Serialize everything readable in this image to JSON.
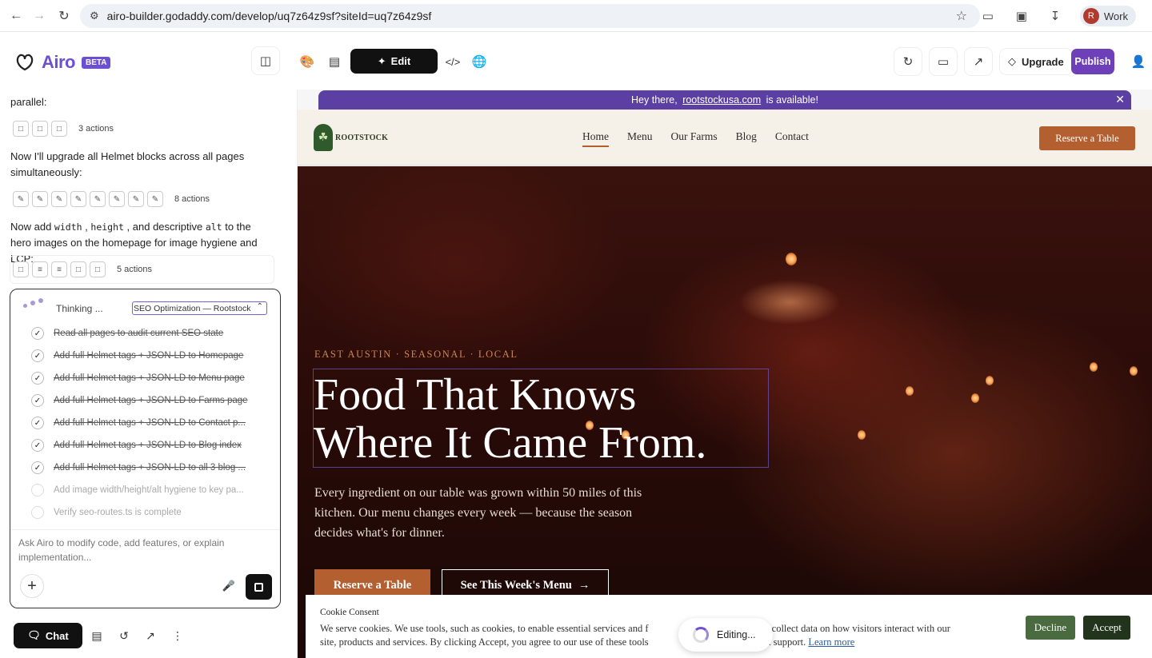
{
  "browser": {
    "url": "airo-builder.godaddy.com/develop/uq7z64z9sf?siteId=uq7z64z9sf",
    "profile_initial": "R",
    "profile_label": "Work"
  },
  "app": {
    "brand": "Airo",
    "badge": "BETA",
    "edit_label": "Edit",
    "upgrade_label": "Upgrade",
    "publish_label": "Publish"
  },
  "chat": {
    "messages": [
      {
        "text": "parallel:"
      },
      {
        "text": "Now I'll upgrade all Helmet blocks across all pages simultaneously:"
      }
    ],
    "msg3": {
      "part1": "Now add ",
      "code1": "width",
      "part2": " , ",
      "code2": "height",
      "part3": " , and descriptive ",
      "code3": "alt",
      "part4": " to the hero images on the homepage for image hygiene and LCP:"
    },
    "action_counts": [
      "3 actions",
      "8 actions",
      "5 actions"
    ],
    "thinking_label": "Thinking ...",
    "task_select_value": "SEO Optimization — Rootstock",
    "tasks": [
      {
        "label": "Read all pages to audit current SEO state",
        "done": true
      },
      {
        "label": "Add full Helmet tags + JSON-LD to Homepage",
        "done": true
      },
      {
        "label": "Add full Helmet tags + JSON-LD to Menu page",
        "done": true
      },
      {
        "label": "Add full Helmet tags + JSON-LD to Farms page",
        "done": true
      },
      {
        "label": "Add full Helmet tags + JSON-LD to Contact p...",
        "done": true
      },
      {
        "label": "Add full Helmet tags + JSON-LD to Blog index",
        "done": true
      },
      {
        "label": "Add full Helmet tags + JSON-LD to all 3 blog ...",
        "done": true
      },
      {
        "label": "Add image width/height/alt hygiene to key pa...",
        "done": false
      },
      {
        "label": "Verify seo-routes.ts is complete",
        "done": false
      }
    ],
    "input_placeholder": "Ask Airo to modify code, add features, or explain implementation...",
    "chat_tab_label": "Chat"
  },
  "site": {
    "promo": {
      "prefix": "Hey there,",
      "domain": "rootstockusa.com",
      "suffix": "is available!"
    },
    "logo_text": "ROOTSTOCK",
    "nav": [
      "Home",
      "Menu",
      "Our Farms",
      "Blog",
      "Contact"
    ],
    "reserve_label": "Reserve a Table",
    "hero": {
      "eyebrow": "EAST AUSTIN · SEASONAL · LOCAL",
      "title_line1": "Food That Knows",
      "title_line2": "Where It Came From.",
      "subtitle": "Every ingredient on our table was grown within 50 miles of this kitchen. Our menu changes every week — because the season decides what's for dinner.",
      "btn_primary": "Reserve a Table",
      "btn_secondary": "See This Week's Menu"
    },
    "cookie": {
      "title": "Cookie Consent",
      "body_line1_a": "We serve cookies. We use tools, such as cookies, to enable essential services and f",
      "body_line1_b": "te and to collect data on how visitors interact with our",
      "body_line2_a": "site, products and services. By clicking Accept, you agree to our use of these tools",
      "body_line2_b": "ytics and support.",
      "learn_more": "Learn more",
      "decline": "Decline",
      "accept": "Accept"
    },
    "editing_label": "Editing..."
  }
}
